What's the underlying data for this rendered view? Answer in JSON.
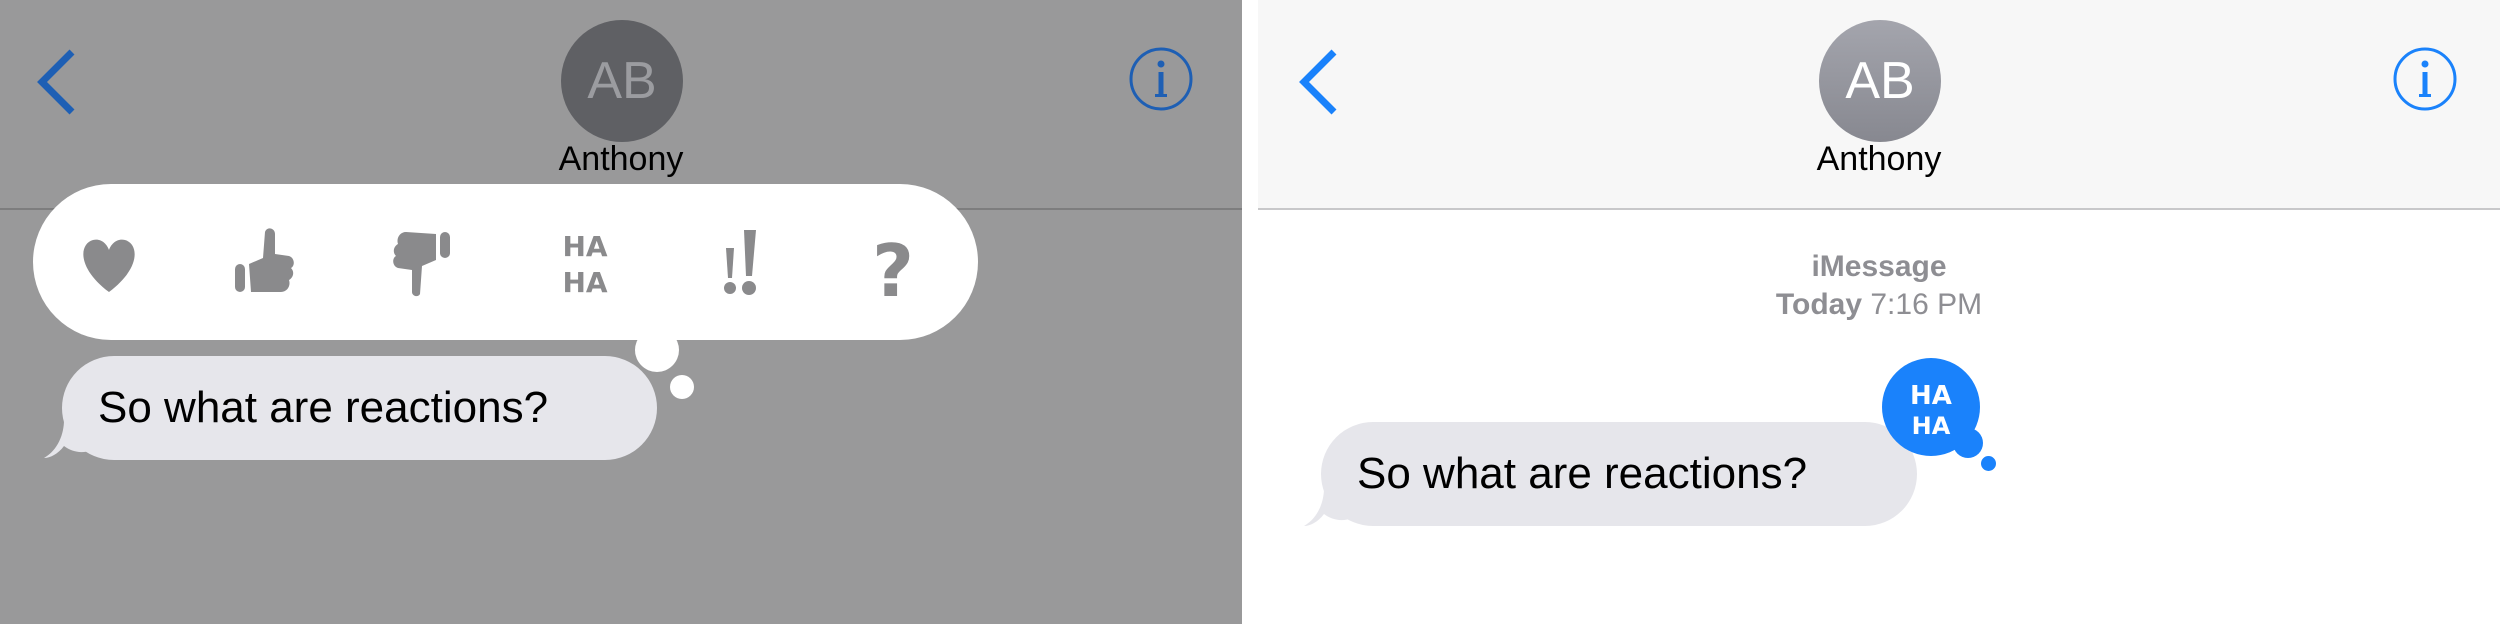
{
  "left_panel": {
    "header": {
      "back_icon": "chevron-left-icon",
      "avatar_initials": "AB",
      "contact_name": "Anthony",
      "info_icon": "info-circle-icon"
    },
    "reactions": [
      {
        "name": "heart",
        "icon": "heart-icon"
      },
      {
        "name": "thumbs-up",
        "icon": "thumbs-up-icon"
      },
      {
        "name": "thumbs-down",
        "icon": "thumbs-down-icon"
      },
      {
        "name": "haha",
        "icon": "haha-icon",
        "text_top": "HA",
        "text_bottom": "HA"
      },
      {
        "name": "exclamation",
        "icon": "double-exclamation-icon"
      },
      {
        "name": "question",
        "icon": "question-mark-icon"
      }
    ],
    "message": "So what are reactions?"
  },
  "right_panel": {
    "header": {
      "back_icon": "chevron-left-icon",
      "avatar_initials": "AB",
      "contact_name": "Anthony",
      "info_icon": "info-circle-icon"
    },
    "service": "iMessage",
    "timestamp_day": "Today",
    "timestamp_time": "7:16 PM",
    "message": "So what are reactions?",
    "reaction_badge": {
      "text_top": "HA",
      "text_bottom": "HA"
    }
  },
  "colors": {
    "accent_left": "#1e5fb4",
    "accent_right": "#1a82fb",
    "bubble": "#e6e6eb",
    "dim": "#99999a",
    "reaction_icon": "#8a8a8c"
  }
}
